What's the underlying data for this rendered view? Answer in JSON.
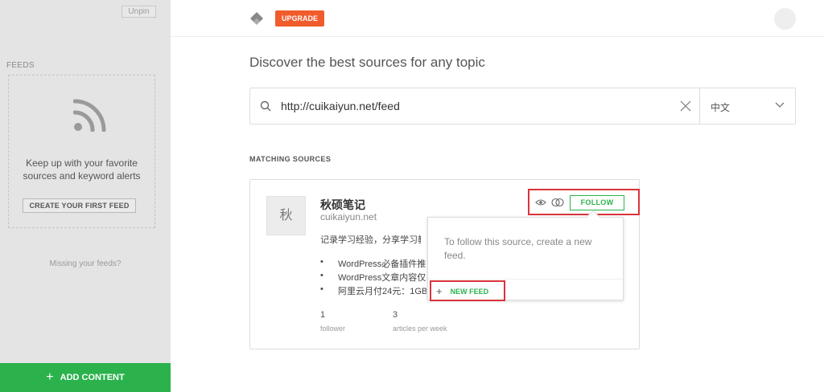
{
  "sidebar": {
    "unpin_label": "Unpin",
    "feeds_heading": "FEEDS",
    "empty_message": "Keep up with your favorite sources and keyword alerts",
    "create_feed_label": "CREATE YOUR FIRST FEED",
    "missing_feeds": "Missing your feeds?",
    "add_content_label": "ADD CONTENT"
  },
  "header": {
    "upgrade_label": "UPGRADE"
  },
  "main": {
    "headline": "Discover the best sources for any topic",
    "search": {
      "value": "http://cuikaiyun.net/feed",
      "language": "中文"
    },
    "matching_heading": "MATCHING SOURCES",
    "source": {
      "avatar_char": "秋",
      "title": "秋硕笔记",
      "domain": "cuikaiyun.net",
      "description": "记录学习经验，分享学习教",
      "articles": [
        {
          "bullet": "•",
          "title": "WordPress必备插件推"
        },
        {
          "bullet": "•",
          "title": "WordPress文章内容仅"
        },
        {
          "bullet": "•",
          "title": "阿里云月付24元：1GB"
        }
      ],
      "followers": "1",
      "followers_label": "follower",
      "articles_per_week": "3",
      "articles_per_week_label": "articles per week",
      "follow_label": "FOLLOW"
    },
    "popover": {
      "message": "To follow this source, create a new feed.",
      "new_feed_label": "NEW FEED"
    }
  },
  "colors": {
    "accent_green": "#2bb24c",
    "upgrade_orange": "#f15c2c",
    "highlight_red": "#d9343c"
  }
}
